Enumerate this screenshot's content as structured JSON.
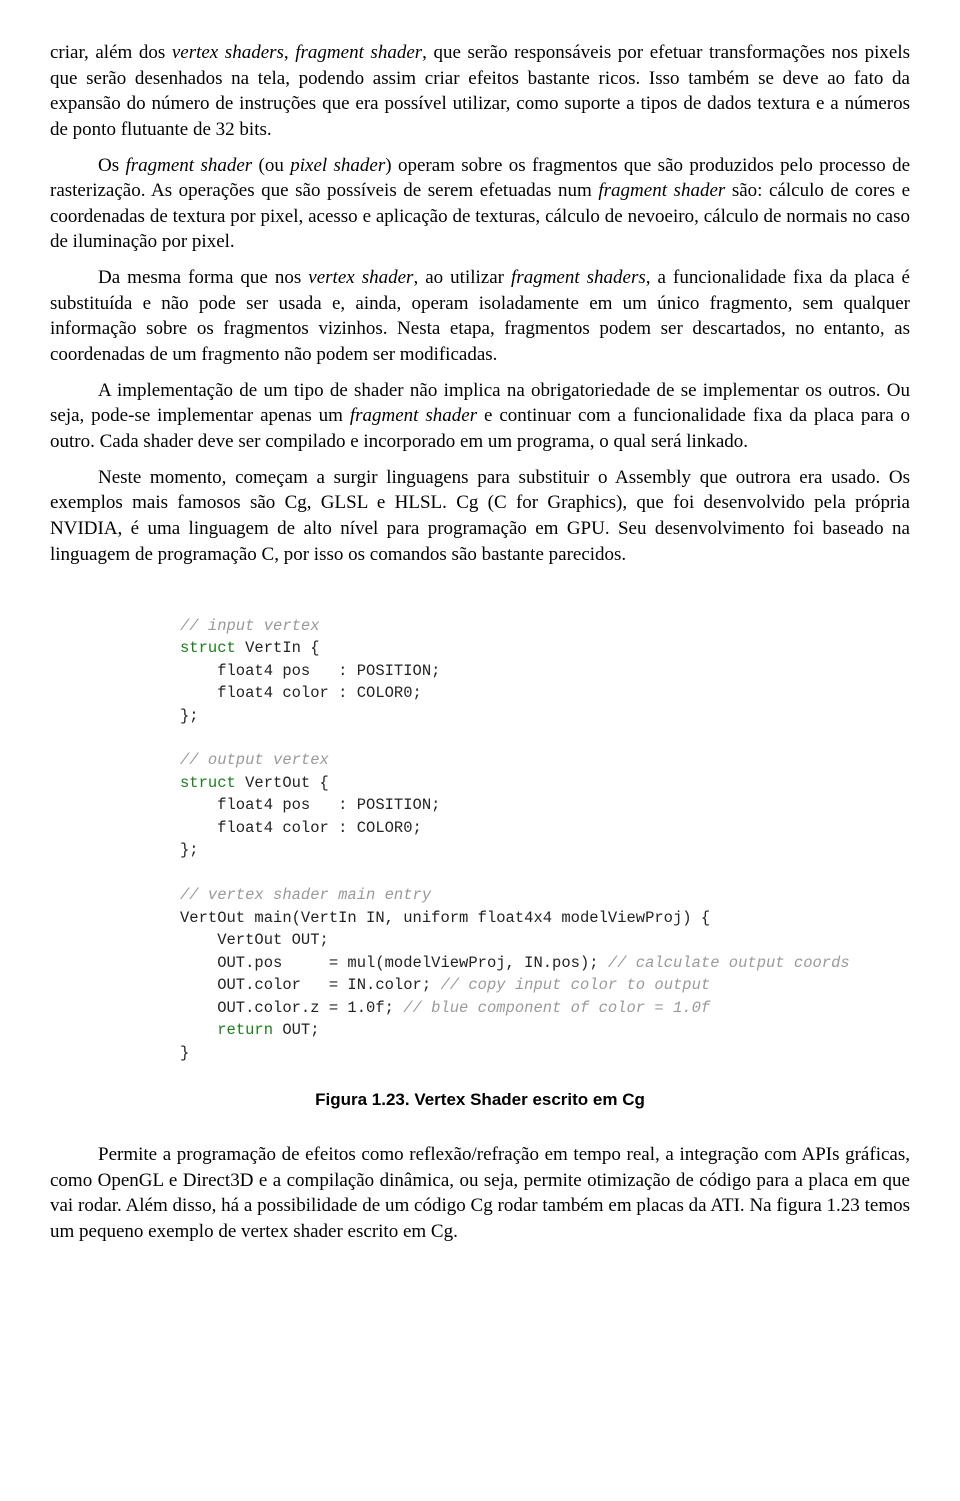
{
  "paragraphs": {
    "p1_part1": "criar, além dos ",
    "p1_i1": "vertex shaders",
    "p1_sep1": ", ",
    "p1_i2": "fragment shader",
    "p1_part2": ", que serão responsáveis por efetuar transformações nos pixels que serão desenhados na tela, podendo assim criar efeitos bastante ricos. Isso também se deve ao fato da expansão do número de instruções que era possível utilizar, como suporte a tipos de dados textura e a números de ponto flutuante de 32 bits.",
    "p2_part1": "Os ",
    "p2_i1": "fragment shader",
    "p2_part2": " (ou ",
    "p2_i2": "pixel shader",
    "p2_part3": ") operam sobre os fragmentos que são produzidos pelo processo de rasterização. As operações que são possíveis de serem efetuadas num ",
    "p2_i3": "fragment shader",
    "p2_part4": " são: cálculo de cores e coordenadas de textura por pixel, acesso e aplicação de texturas, cálculo de nevoeiro, cálculo de normais no caso de iluminação por pixel.",
    "p3_part1": "Da mesma forma que nos ",
    "p3_i1": "vertex shader",
    "p3_part2": ", ao utilizar ",
    "p3_i2": "fragment shaders",
    "p3_part3": ", a funcionalidade fixa da placa é substituída e não pode ser usada e, ainda, operam isoladamente em um único fragmento, sem qualquer informação sobre os fragmentos vizinhos. Nesta etapa, fragmentos podem ser descartados, no entanto, as coordenadas de um fragmento não podem ser modificadas.",
    "p4_part1": "A implementação de um tipo de shader não implica na obrigatoriedade de se implementar os outros. Ou seja, pode-se implementar apenas um ",
    "p4_i1": "fragment shader",
    "p4_part2": " e continuar com a funcionalidade fixa da placa para o outro. Cada shader deve ser compilado e incorporado em um programa, o qual será linkado.",
    "p5": "Neste momento, começam a surgir linguagens para substituir o Assembly que outrora era usado. Os exemplos mais famosos são Cg, GLSL e HLSL. Cg (C for Graphics), que foi desenvolvido pela própria NVIDIA, é uma linguagem de alto nível para programação em GPU. Seu desenvolvimento foi baseado na linguagem de programação C, por isso os comandos são bastante parecidos.",
    "p6": "Permite a programação de efeitos como reflexão/refração em tempo real, a integração com APIs gráficas, como OpenGL e Direct3D e a compilação dinâmica, ou seja, permite otimização de código para a placa em que vai rodar. Além disso, há a possibilidade de um código Cg rodar também em placas da ATI. Na figura 1.23 temos um pequeno exemplo de vertex shader escrito em Cg."
  },
  "code": {
    "c01": "// input vertex",
    "l02a": "struct",
    "l02b": " VertIn {",
    "l03": "    float4 pos   : POSITION;",
    "l04": "    float4 color : COLOR0;",
    "l05": "};",
    "c06": "// output vertex",
    "l07a": "struct",
    "l07b": " VertOut {",
    "l08": "    float4 pos   : POSITION;",
    "l09": "    float4 color : COLOR0;",
    "l10": "};",
    "c11": "// vertex shader main entry",
    "l12": "VertOut main(VertIn IN, uniform float4x4 modelViewProj) {",
    "l13": "    VertOut OUT;",
    "l14a": "    OUT.pos     = mul(modelViewProj, IN.pos); ",
    "c14b": "// calculate output coords",
    "l15a": "    OUT.color   = IN.color; ",
    "c15b": "// copy input color to output",
    "l16a": "    OUT.color.z = 1.0f; ",
    "c16b": "// blue component of color = 1.0f",
    "l17a": "    ",
    "l17b": "return",
    "l17c": " OUT;",
    "l18": "}"
  },
  "caption": "Figura 1.23. Vertex Shader escrito em Cg"
}
